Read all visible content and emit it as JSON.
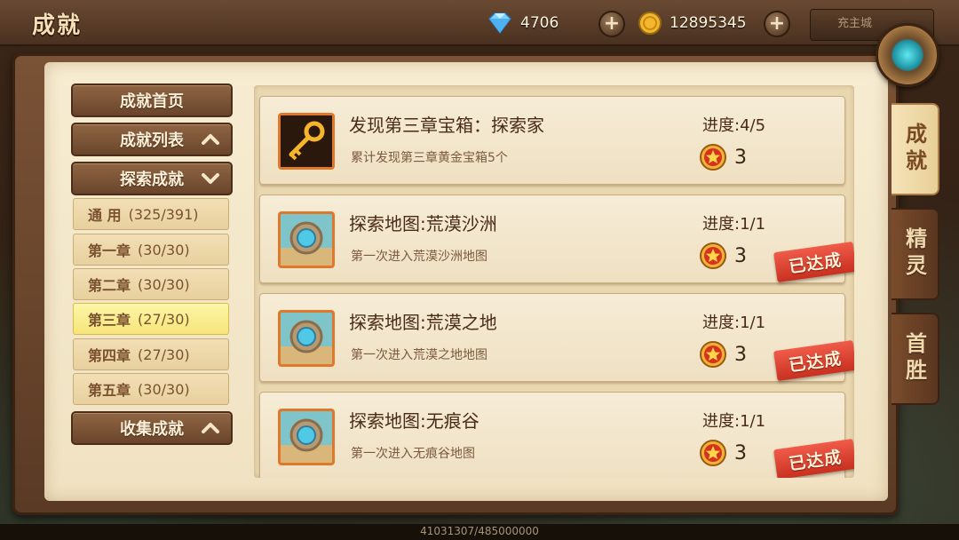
{
  "header": {
    "title": "成就",
    "gems": "4706",
    "gold": "12895345",
    "back_city": "充主城"
  },
  "menu": {
    "home": "成就首页",
    "list": "成就列表",
    "explore": "探索成就",
    "collect": "收集成就",
    "sub_items": [
      {
        "name": "通 用",
        "count": "(325/391)"
      },
      {
        "name": "第一章",
        "count": "(30/30)"
      },
      {
        "name": "第二章",
        "count": "(30/30)"
      },
      {
        "name": "第三章",
        "count": "(27/30)"
      },
      {
        "name": "第四章",
        "count": "(27/30)"
      },
      {
        "name": "第五章",
        "count": "(30/30)"
      }
    ]
  },
  "achievements": [
    {
      "title": "发现第三章宝箱：探索家",
      "desc": "累计发现第三章黄金宝箱5个",
      "progress": "进度:4/5",
      "reward": "3",
      "icon": "golden-key-icon"
    },
    {
      "title": "探索地图:荒漠沙洲",
      "desc": "第一次进入荒漠沙洲地图",
      "progress": "进度:1/1",
      "reward": "3",
      "icon": "map-portal-icon",
      "stamp": "已达成"
    },
    {
      "title": "探索地图:荒漠之地",
      "desc": "第一次进入荒漠之地地图",
      "progress": "进度:1/1",
      "reward": "3",
      "icon": "map-portal-icon",
      "stamp": "已达成"
    },
    {
      "title": "探索地图:无痕谷",
      "desc": "第一次进入无痕谷地图",
      "progress": "进度:1/1",
      "reward": "3",
      "icon": "map-portal-icon",
      "stamp": "已达成"
    }
  ],
  "side_tabs": [
    "成就",
    "精灵",
    "首胜"
  ],
  "footer": {
    "exp": "41031307/485000000"
  },
  "colors": {
    "accent": "#e0782c",
    "stamp": "#d83a28",
    "parchment": "#f4e7cb"
  }
}
